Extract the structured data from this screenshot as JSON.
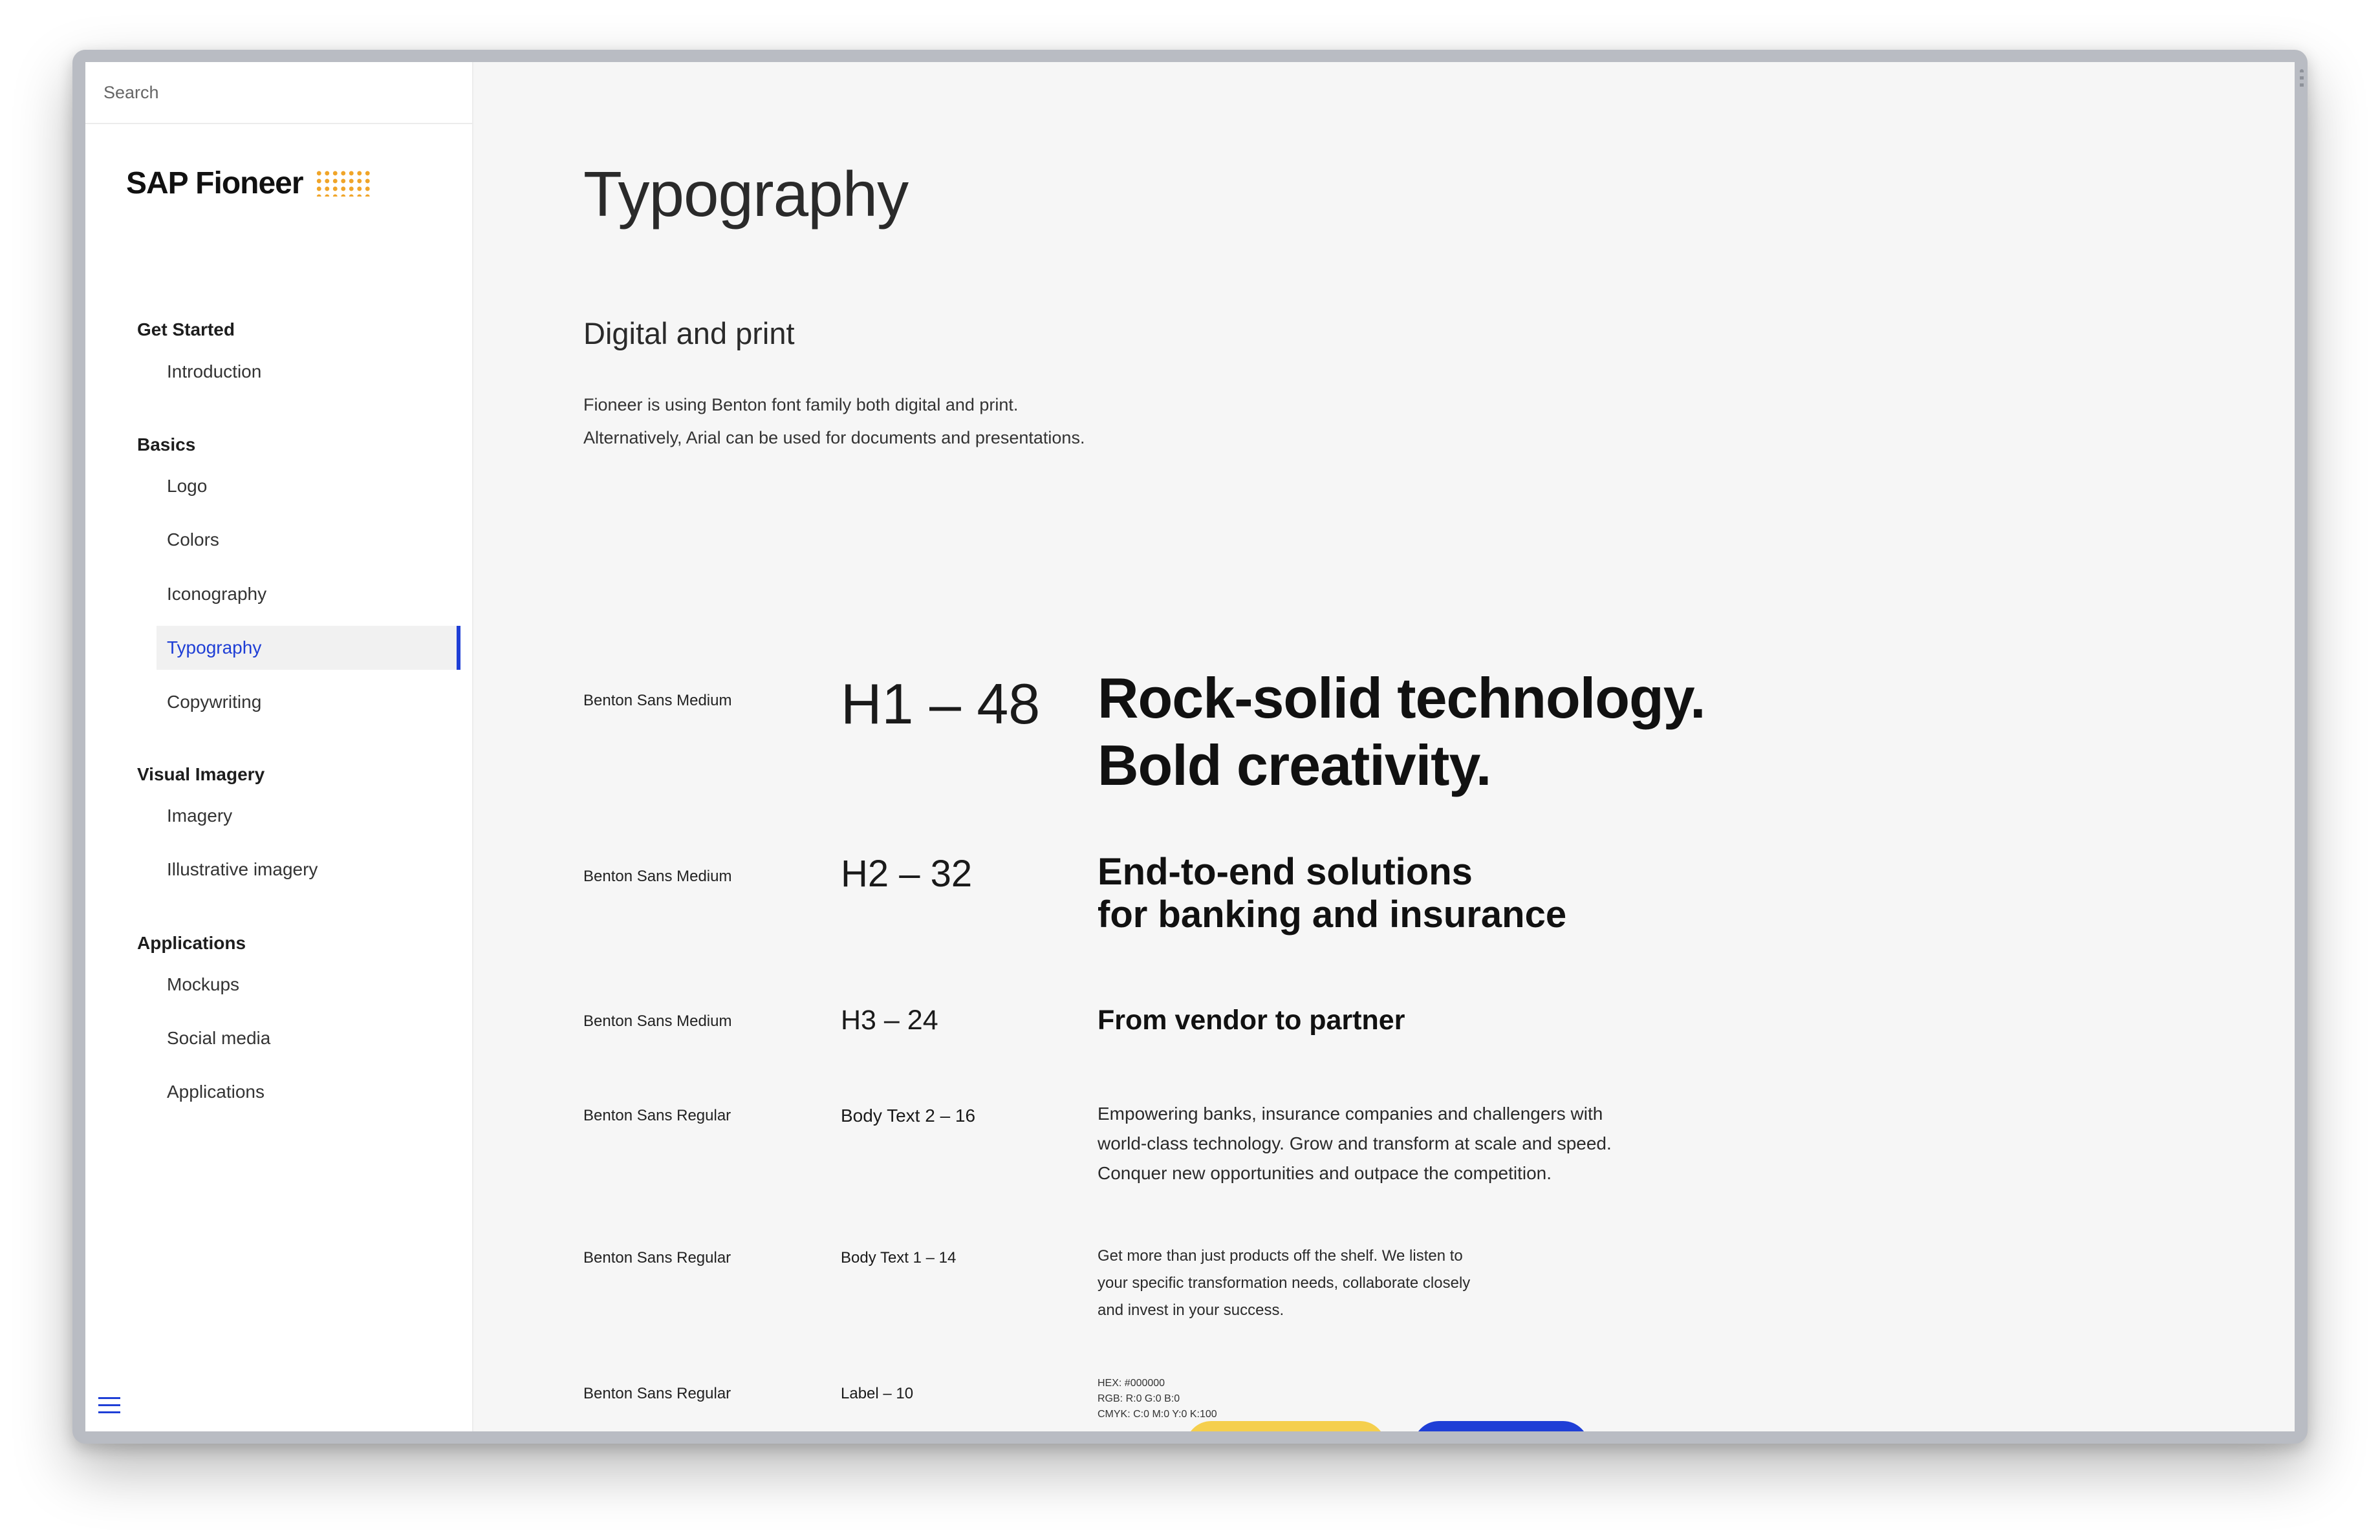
{
  "search": {
    "placeholder": "Search"
  },
  "logo": {
    "text": "SAP Fioneer"
  },
  "nav": {
    "sections": [
      {
        "title": "Get Started",
        "items": [
          "Introduction"
        ]
      },
      {
        "title": "Basics",
        "items": [
          "Logo",
          "Colors",
          "Iconography",
          "Typography",
          "Copywriting"
        ]
      },
      {
        "title": "Visual Imagery",
        "items": [
          "Imagery",
          "Illustrative imagery"
        ]
      },
      {
        "title": "Applications",
        "items": [
          "Mockups",
          "Social media",
          "Applications"
        ]
      }
    ],
    "active_item": "Typography"
  },
  "page": {
    "title": "Typography",
    "subtitle": "Digital and print",
    "intro_line1": "Fioneer is using Benton font family both digital and print.",
    "intro_line2": "Alternatively, Arial can be used for documents and presentations."
  },
  "type_scale": [
    {
      "font": "Benton Sans Medium",
      "spec": "H1 – 48",
      "sample_lines": [
        "Rock-solid technology.",
        "Bold creativity."
      ]
    },
    {
      "font": "Benton Sans Medium",
      "spec": "H2 – 32",
      "sample_lines": [
        "End-to-end solutions",
        "for banking and insurance"
      ]
    },
    {
      "font": "Benton Sans Medium",
      "spec": "H3 – 24",
      "sample_lines": [
        "From vendor to partner"
      ]
    },
    {
      "font": "Benton Sans Regular",
      "spec": "Body Text 2 – 16",
      "sample_lines": [
        "Empowering banks, insurance companies and challengers with",
        "world-class technology. Grow and transform at scale and speed.",
        "Conquer new opportunities and outpace the competition."
      ]
    },
    {
      "font": "Benton Sans Regular",
      "spec": "Body Text 1 – 14",
      "sample_lines": [
        "Get more than just products off the shelf. We listen to",
        "your specific transformation needs, collaborate closely",
        "and invest in your success."
      ]
    },
    {
      "font": "Benton Sans Regular",
      "spec": "Label – 10",
      "sample_lines": [
        "HEX: #000000",
        "RGB:  R:0  G:0  B:0",
        "CMYK:  C:0  M:0  Y:0  K:100"
      ]
    }
  ],
  "colors": {
    "accent": "#1f3fd6",
    "logo_dots": "#f0a529",
    "chip_yellow": "#f5cf4d",
    "chip_blue": "#1f3fd6"
  }
}
